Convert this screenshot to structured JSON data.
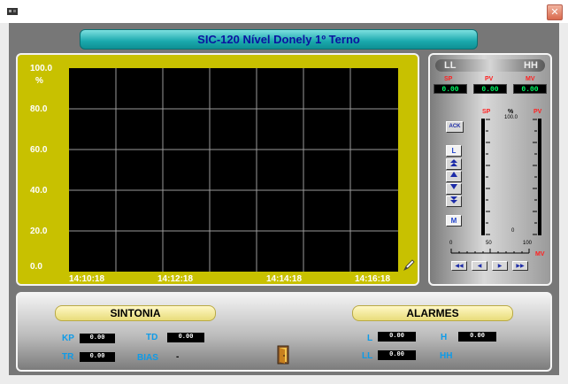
{
  "window": {
    "close_label": "✕"
  },
  "title": "SIC-120 Nível Donely 1º Terno",
  "trend": {
    "y_unit": "%",
    "y_ticks": [
      "100.0",
      "80.0",
      "60.0",
      "40.0",
      "20.0",
      "0.0"
    ],
    "x_ticks": [
      "14:10:18",
      "14:12:18",
      "14:14:18",
      "14:16:18"
    ]
  },
  "faceplate": {
    "tag_ll": "LL",
    "tag_hh": "HH",
    "sp_label": "SP",
    "pv_label": "PV",
    "mv_label": "MV",
    "sp_value": "0.00",
    "pv_value": "0.00",
    "mv_value": "0.00",
    "scale_sp": "SP",
    "scale_unit": "%",
    "scale_pv": "PV",
    "scale_top": "100.0",
    "scale_bottom": "0",
    "ack_label": "ACK",
    "l_label": "L",
    "m_label": "M",
    "mv_axis_label": "MV",
    "mv_ticks": [
      "0",
      "50",
      "100"
    ]
  },
  "sintonia": {
    "title": "SINTONIA",
    "kp_label": "KP",
    "kp_value": "0.00",
    "td_label": "TD",
    "td_value": "0.00",
    "tr_label": "TR",
    "tr_value": "0.00",
    "bias_label": "BIAS",
    "bias_value": "-"
  },
  "alarmes": {
    "title": "ALARMES",
    "l_label": "L",
    "l_value": "0.00",
    "h_label": "H",
    "h_value": "0.00",
    "ll_label": "LL",
    "ll_value": "0.00",
    "hh_label": "HH"
  },
  "colors": {
    "trend_panel": "#c8c100",
    "title_text": "#0b13a0",
    "param_label": "#0e9be8",
    "value_text": "#00ff66",
    "alarm_red": "#ff2020"
  }
}
